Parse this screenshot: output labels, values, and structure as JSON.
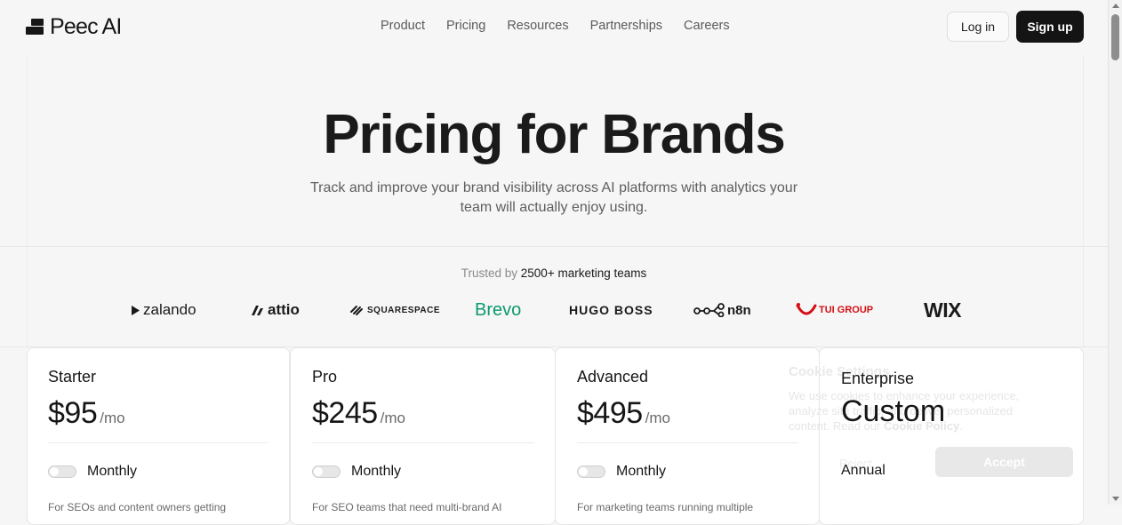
{
  "brand": {
    "name": "Peec AI"
  },
  "nav": {
    "links": [
      "Product",
      "Pricing",
      "Resources",
      "Partnerships",
      "Careers"
    ],
    "login": "Log in",
    "signup": "Sign up"
  },
  "hero": {
    "title": "Pricing for Brands",
    "subtitle": "Track and improve your brand visibility across AI platforms with analytics your team will actually enjoy using."
  },
  "trusted": {
    "prefix": "Trusted by",
    "highlight": "2500+ marketing teams"
  },
  "logos": [
    "zalando",
    "attio",
    "SQUARESPACE",
    "Brevo",
    "HUGO BOSS",
    "n8n",
    "TUI GROUP",
    "WIX"
  ],
  "plans": [
    {
      "name": "Starter",
      "price": "$95",
      "per": "/mo",
      "billing": "Monthly",
      "desc": "For SEOs and content owners getting"
    },
    {
      "name": "Pro",
      "price": "$245",
      "per": "/mo",
      "billing": "Monthly",
      "desc": "For SEO teams that need multi-brand AI"
    },
    {
      "name": "Advanced",
      "price": "$495",
      "per": "/mo",
      "billing": "Monthly",
      "desc": "For marketing teams running multiple"
    }
  ],
  "enterprise": {
    "name": "Enterprise",
    "price": "Custom",
    "billing": "Annual"
  },
  "cookie": {
    "title": "Cookie Settings",
    "text": "We use cookies to enhance your experience, analyze site traffic, and deliver personalized content. Read our",
    "link": "Cookie Policy",
    "reject": "Reject",
    "accept": "Accept"
  },
  "colors": {
    "accent": "#141414",
    "brevo": "#0b996e",
    "tui": "#d40e14",
    "background": "#f6f6f6"
  }
}
